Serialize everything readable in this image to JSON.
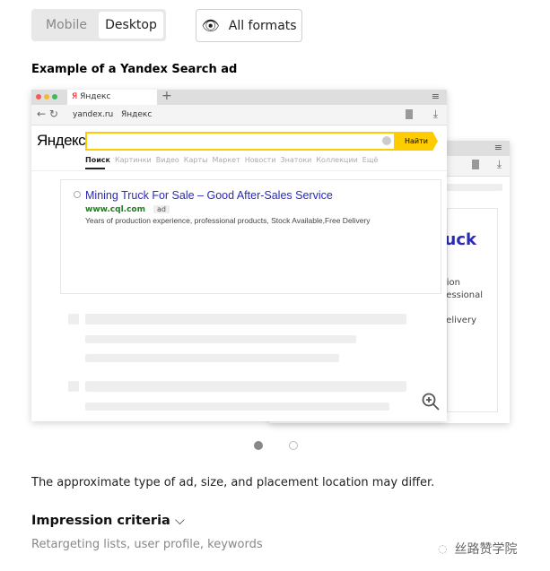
{
  "toggle": {
    "mobile": "Mobile",
    "desktop": "Desktop"
  },
  "formats_button": "All formats",
  "heading": "Example of a Yandex Search ad",
  "browser": {
    "tab_title": "Яндекс",
    "new_tab": "+",
    "url": "yandex.ru",
    "page_title": "Яндекс",
    "logo": "Яндекс",
    "search_button": "Найти",
    "nav": [
      "Поиск",
      "Картинки",
      "Видео",
      "Карты",
      "Маркет",
      "Новости",
      "Знатоки",
      "Коллекции",
      "Ещё"
    ]
  },
  "ad": {
    "title": "Mining Truck For Sale – Good After-Sales Service",
    "url": "www.cql.com",
    "badge": "ad",
    "description": "Years of production experience, professional products, Stock Available,Free Delivery"
  },
  "back_ad": {
    "title": "Mining Truck",
    "line1": "Years of production",
    "line2": "experience, professional",
    "line3": "Stock Available,Free Delivery"
  },
  "carousel": {
    "slides": 2,
    "active": 1
  },
  "disclaimer": "The approximate type of ad, size, and placement location may differ.",
  "criteria": {
    "title": "Impression criteria",
    "subtitle": "Retargeting lists, user profile, keywords"
  },
  "watermark": "丝路赞学院",
  "colors": {
    "link": "#2a2ab8",
    "url_green": "#1a7f1a",
    "yandex_yellow": "#ffcc00",
    "logo_red": "#f00"
  }
}
